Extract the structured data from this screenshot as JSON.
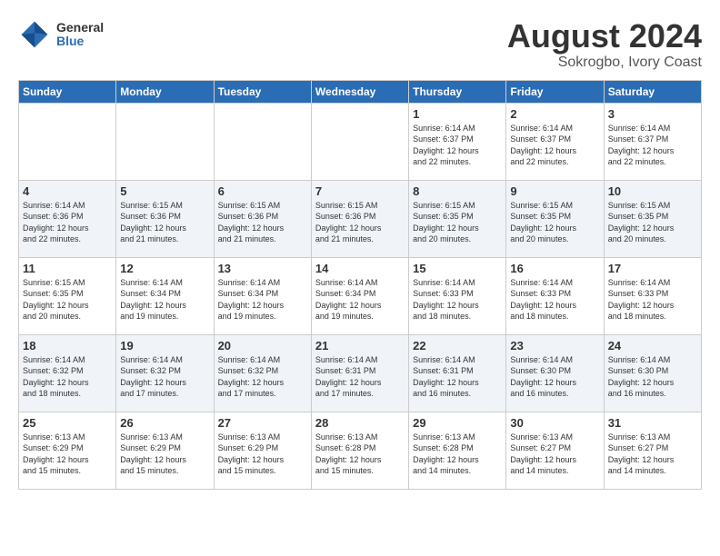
{
  "header": {
    "logo_general": "General",
    "logo_blue": "Blue",
    "title": "August 2024",
    "subtitle": "Sokrogbo, Ivory Coast"
  },
  "days_of_week": [
    "Sunday",
    "Monday",
    "Tuesday",
    "Wednesday",
    "Thursday",
    "Friday",
    "Saturday"
  ],
  "weeks": [
    [
      {
        "day": "",
        "info": ""
      },
      {
        "day": "",
        "info": ""
      },
      {
        "day": "",
        "info": ""
      },
      {
        "day": "",
        "info": ""
      },
      {
        "day": "1",
        "info": "Sunrise: 6:14 AM\nSunset: 6:37 PM\nDaylight: 12 hours\nand 22 minutes."
      },
      {
        "day": "2",
        "info": "Sunrise: 6:14 AM\nSunset: 6:37 PM\nDaylight: 12 hours\nand 22 minutes."
      },
      {
        "day": "3",
        "info": "Sunrise: 6:14 AM\nSunset: 6:37 PM\nDaylight: 12 hours\nand 22 minutes."
      }
    ],
    [
      {
        "day": "4",
        "info": "Sunrise: 6:14 AM\nSunset: 6:36 PM\nDaylight: 12 hours\nand 22 minutes."
      },
      {
        "day": "5",
        "info": "Sunrise: 6:15 AM\nSunset: 6:36 PM\nDaylight: 12 hours\nand 21 minutes."
      },
      {
        "day": "6",
        "info": "Sunrise: 6:15 AM\nSunset: 6:36 PM\nDaylight: 12 hours\nand 21 minutes."
      },
      {
        "day": "7",
        "info": "Sunrise: 6:15 AM\nSunset: 6:36 PM\nDaylight: 12 hours\nand 21 minutes."
      },
      {
        "day": "8",
        "info": "Sunrise: 6:15 AM\nSunset: 6:35 PM\nDaylight: 12 hours\nand 20 minutes."
      },
      {
        "day": "9",
        "info": "Sunrise: 6:15 AM\nSunset: 6:35 PM\nDaylight: 12 hours\nand 20 minutes."
      },
      {
        "day": "10",
        "info": "Sunrise: 6:15 AM\nSunset: 6:35 PM\nDaylight: 12 hours\nand 20 minutes."
      }
    ],
    [
      {
        "day": "11",
        "info": "Sunrise: 6:15 AM\nSunset: 6:35 PM\nDaylight: 12 hours\nand 20 minutes."
      },
      {
        "day": "12",
        "info": "Sunrise: 6:14 AM\nSunset: 6:34 PM\nDaylight: 12 hours\nand 19 minutes."
      },
      {
        "day": "13",
        "info": "Sunrise: 6:14 AM\nSunset: 6:34 PM\nDaylight: 12 hours\nand 19 minutes."
      },
      {
        "day": "14",
        "info": "Sunrise: 6:14 AM\nSunset: 6:34 PM\nDaylight: 12 hours\nand 19 minutes."
      },
      {
        "day": "15",
        "info": "Sunrise: 6:14 AM\nSunset: 6:33 PM\nDaylight: 12 hours\nand 18 minutes."
      },
      {
        "day": "16",
        "info": "Sunrise: 6:14 AM\nSunset: 6:33 PM\nDaylight: 12 hours\nand 18 minutes."
      },
      {
        "day": "17",
        "info": "Sunrise: 6:14 AM\nSunset: 6:33 PM\nDaylight: 12 hours\nand 18 minutes."
      }
    ],
    [
      {
        "day": "18",
        "info": "Sunrise: 6:14 AM\nSunset: 6:32 PM\nDaylight: 12 hours\nand 18 minutes."
      },
      {
        "day": "19",
        "info": "Sunrise: 6:14 AM\nSunset: 6:32 PM\nDaylight: 12 hours\nand 17 minutes."
      },
      {
        "day": "20",
        "info": "Sunrise: 6:14 AM\nSunset: 6:32 PM\nDaylight: 12 hours\nand 17 minutes."
      },
      {
        "day": "21",
        "info": "Sunrise: 6:14 AM\nSunset: 6:31 PM\nDaylight: 12 hours\nand 17 minutes."
      },
      {
        "day": "22",
        "info": "Sunrise: 6:14 AM\nSunset: 6:31 PM\nDaylight: 12 hours\nand 16 minutes."
      },
      {
        "day": "23",
        "info": "Sunrise: 6:14 AM\nSunset: 6:30 PM\nDaylight: 12 hours\nand 16 minutes."
      },
      {
        "day": "24",
        "info": "Sunrise: 6:14 AM\nSunset: 6:30 PM\nDaylight: 12 hours\nand 16 minutes."
      }
    ],
    [
      {
        "day": "25",
        "info": "Sunrise: 6:13 AM\nSunset: 6:29 PM\nDaylight: 12 hours\nand 15 minutes."
      },
      {
        "day": "26",
        "info": "Sunrise: 6:13 AM\nSunset: 6:29 PM\nDaylight: 12 hours\nand 15 minutes."
      },
      {
        "day": "27",
        "info": "Sunrise: 6:13 AM\nSunset: 6:29 PM\nDaylight: 12 hours\nand 15 minutes."
      },
      {
        "day": "28",
        "info": "Sunrise: 6:13 AM\nSunset: 6:28 PM\nDaylight: 12 hours\nand 15 minutes."
      },
      {
        "day": "29",
        "info": "Sunrise: 6:13 AM\nSunset: 6:28 PM\nDaylight: 12 hours\nand 14 minutes."
      },
      {
        "day": "30",
        "info": "Sunrise: 6:13 AM\nSunset: 6:27 PM\nDaylight: 12 hours\nand 14 minutes."
      },
      {
        "day": "31",
        "info": "Sunrise: 6:13 AM\nSunset: 6:27 PM\nDaylight: 12 hours\nand 14 minutes."
      }
    ]
  ]
}
